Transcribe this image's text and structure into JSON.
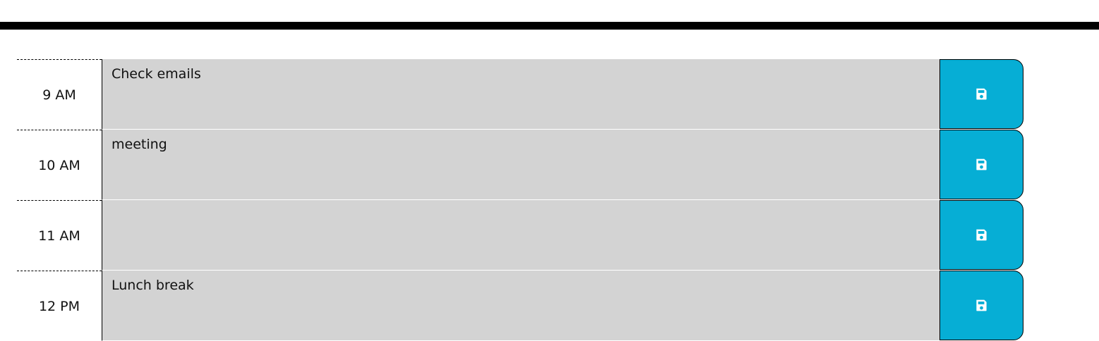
{
  "colors": {
    "header_rule": "#000000",
    "description_bg": "#d3d3d3",
    "save_button_bg": "#06aed5",
    "save_icon": "#ffffff"
  },
  "save_icon": "floppy-disk-icon",
  "schedule": {
    "rows": [
      {
        "hour": "9 AM",
        "description": "Check emails"
      },
      {
        "hour": "10 AM",
        "description": "meeting"
      },
      {
        "hour": "11 AM",
        "description": ""
      },
      {
        "hour": "12 PM",
        "description": "Lunch break"
      }
    ]
  }
}
